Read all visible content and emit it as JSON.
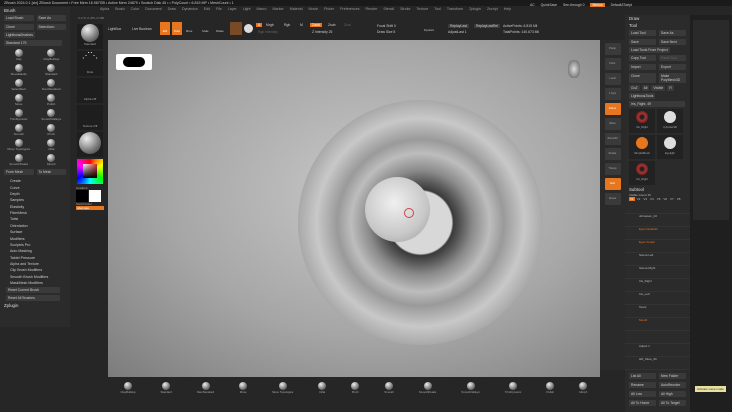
{
  "title": "ZBrush 2024.0.1 [ctx]  ZBrush Document   • Free Mem 16.987GB • Active Mem 24879 • Scratch Disk 45 • • PolyCount • 6.815 MP • MeshCount • 1",
  "menu": [
    "Alpha",
    "Brush",
    "Color",
    "Document",
    "Draw",
    "Dynamics",
    "Edit",
    "File",
    "Layer",
    "Light",
    "Macro",
    "Marker",
    "Material",
    "Movie",
    "Picker",
    "Preferences",
    "Render",
    "Stencil",
    "Stroke",
    "Texture",
    "Tool",
    "Transform",
    "Zplugin",
    "Zscript",
    "Help"
  ],
  "top_status": {
    "ac": "AC",
    "quicksave": "QuickSave",
    "seethrough": "See-through 0",
    "menus": "Menus",
    "script": "DefaultZScript"
  },
  "coords": "0.170,-0.465,-0.380",
  "top_toolbar": {
    "home": "Home Page",
    "lightbox": "LightBox",
    "live_boolean": "Live Boolean",
    "edit": "Edit",
    "draw": "Draw",
    "move": "Move",
    "scale": "Scale",
    "rotate": "Rotate",
    "a": "A",
    "mrgb": "Mrgb",
    "rgb": "Rgb",
    "m": "M",
    "zadd": "Zadd",
    "zsub": "Zsub",
    "zcut": "Zcut",
    "rgb_intensity": "Rgb Intensity",
    "z_intensity": "Z Intensity 25",
    "focal_shift": "Focal Shift 0",
    "draw_size": "Draw Size 5",
    "dynamic": "Dynamic",
    "replay_last": "ReplayLast",
    "replay_last_rel": "ReplayLastRel",
    "adjust_last": "AdjustLast 1",
    "active_points": "ActivePoints: 6.815 Mil",
    "total_points": "TotalPoints: 140.673 Mil"
  },
  "brush_panel": {
    "title": "Brush",
    "load": "Load Brush",
    "save_as": "Save As",
    "clone": "Clone",
    "select_icon": "SelectIcon",
    "lightbox_brushes": "Lightbox▸Brushes",
    "slider": "Standard  179",
    "current": "Standard",
    "brushes": [
      "Clay",
      "ClayBuildup",
      "MoveElastic",
      "Standard",
      "SelectRect",
      "DamStandard",
      "Move",
      "Polish",
      "TrimDynamic",
      "SmoothValleys",
      "Smooth",
      "Pinch",
      "Move Topologica",
      "Inflat",
      "SmoothPeaks",
      "Morph"
    ],
    "from_mesh": "From Mesh",
    "to_mesh": "To Mesh",
    "subpalettes": [
      "Create",
      "Curve",
      "Depth",
      "Samples",
      "Elasticity",
      "FiberMesh",
      "Twist",
      "Orientation",
      "Surface",
      "Modifiers",
      "Sculptris Pro",
      "Auto Masking",
      "Tablet Pressure",
      "Alpha and Texture",
      "Clip Brush Modifiers",
      "Smooth Brush Modifiers",
      "MaskMesh Modifiers"
    ],
    "reset_current": "Reset Current Brush",
    "reset_all": "Reset All Brushes",
    "zplugin": "Zplugin"
  },
  "shelf": {
    "brush": "Standard",
    "stroke": "Dots",
    "alpha": "Alpha Off",
    "texture": "Texture Off",
    "material": "SkinShade4",
    "gradient": "Gradient",
    "switch_color": "SwitchColor",
    "alternate": "Alternate"
  },
  "right_toolbar": [
    "Persp",
    "Floor",
    "Local",
    "L.Sym",
    "Frame",
    "Move",
    "Zoom3D",
    "Rotate",
    "Transp",
    "Solo",
    "Xpose"
  ],
  "tool_panel": {
    "draw": "Draw",
    "title": "Tool",
    "load_tool": "Load Tool",
    "save_as": "Save As",
    "save": "Save",
    "save_next": "Save Next",
    "load_from_project": "Load Tools From Project",
    "copy_tool": "Copy Tool",
    "paste_tool": "Paste Tool",
    "import": "Import",
    "export": "Export",
    "clone": "Clone",
    "make_polymesh": "Make PolyMesh3D",
    "goz": "GoZ",
    "all": "All",
    "visible": "Visible",
    "r": "R",
    "lightbox_tools": "Lightbox▸Tools",
    "slider": "Iris_Right. 49",
    "thumbs": [
      "Iris_Right",
      "Cylinder3D",
      "SimpleBrush",
      "Eyelight",
      "Iris_Right"
    ],
    "subtool": "Subtool",
    "visible_count": "Visible Count 15",
    "tabs": [
      "V1",
      "V2",
      "V3",
      "V4",
      "V5",
      "V6",
      "V7",
      "V8"
    ],
    "rows": [
      "",
      "ultimatum_02",
      "Eyes Realistic",
      "Eyes Sculpt",
      "Sclera Left",
      "Sclera Right",
      "Iris_Right",
      "Iris_Left",
      "Tears",
      "Mouth",
      "",
      "Adjust 1",
      "HD_Mute_09"
    ],
    "list_all": "List All",
    "new_folder": "New Folder",
    "rename": "Rename",
    "autoreorder": "AutoReorder",
    "all_low": "All Low",
    "all_high": "All High",
    "all_to_home": "All To Home",
    "all_to_target": "All To Target"
  },
  "bottom_brushes": [
    "ClayBuildup",
    "Standard",
    "DamStandard",
    "Move",
    "Move Topologica",
    "Inflat",
    "Pinch",
    "Smooth",
    "SmoothPeaks",
    "SmoothValleys",
    "TrimDynamic",
    "Polish",
    "Morph"
  ],
  "tooltip": "Activate voice mode"
}
